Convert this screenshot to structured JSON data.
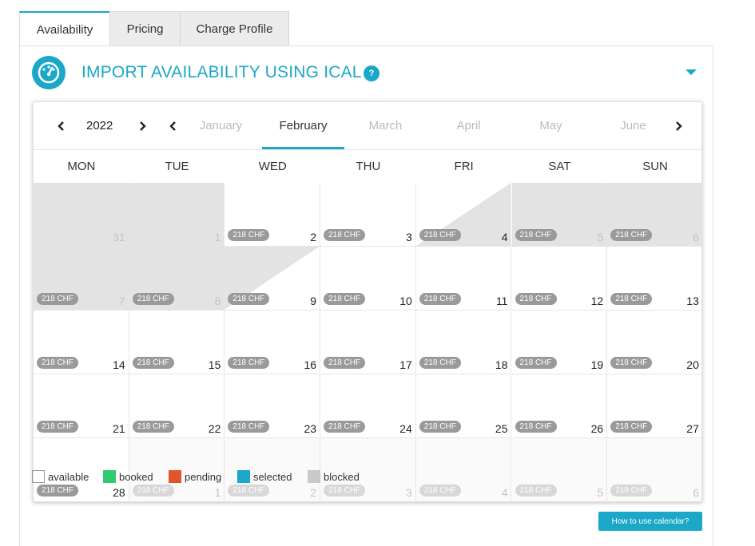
{
  "tabs": [
    {
      "label": "Availability"
    },
    {
      "label": "Pricing"
    },
    {
      "label": "Charge Profile"
    }
  ],
  "panel": {
    "title": "IMPORT AVAILABILITY USING ICAL",
    "help": "?",
    "icon": "speedometer-icon"
  },
  "calendar": {
    "year": "2022",
    "months": [
      "January",
      "February",
      "March",
      "April",
      "May",
      "June"
    ],
    "active_month": "February",
    "weekdays": [
      "MON",
      "TUE",
      "WED",
      "THU",
      "FRI",
      "SAT",
      "SUN"
    ],
    "days": [
      {
        "day": "31",
        "price": "",
        "state": "blocked"
      },
      {
        "day": "1",
        "price": "",
        "state": "blocked"
      },
      {
        "day": "2",
        "price": "218 CHF",
        "state": "available"
      },
      {
        "day": "3",
        "price": "218 CHF",
        "state": "available"
      },
      {
        "day": "4",
        "price": "218 CHF",
        "state": "blocked-start"
      },
      {
        "day": "5",
        "price": "218 CHF",
        "state": "blocked"
      },
      {
        "day": "6",
        "price": "218 CHF",
        "state": "blocked"
      },
      {
        "day": "7",
        "price": "218 CHF",
        "state": "blocked"
      },
      {
        "day": "8",
        "price": "218 CHF",
        "state": "blocked"
      },
      {
        "day": "9",
        "price": "218 CHF",
        "state": "blocked-end"
      },
      {
        "day": "10",
        "price": "218 CHF",
        "state": "available"
      },
      {
        "day": "11",
        "price": "218 CHF",
        "state": "available"
      },
      {
        "day": "12",
        "price": "218 CHF",
        "state": "available"
      },
      {
        "day": "13",
        "price": "218 CHF",
        "state": "available"
      },
      {
        "day": "14",
        "price": "218 CHF",
        "state": "available"
      },
      {
        "day": "15",
        "price": "218 CHF",
        "state": "available"
      },
      {
        "day": "16",
        "price": "218 CHF",
        "state": "available"
      },
      {
        "day": "17",
        "price": "218 CHF",
        "state": "available"
      },
      {
        "day": "18",
        "price": "218 CHF",
        "state": "available"
      },
      {
        "day": "19",
        "price": "218 CHF",
        "state": "available"
      },
      {
        "day": "20",
        "price": "218 CHF",
        "state": "available"
      },
      {
        "day": "21",
        "price": "218 CHF",
        "state": "available"
      },
      {
        "day": "22",
        "price": "218 CHF",
        "state": "available"
      },
      {
        "day": "23",
        "price": "218 CHF",
        "state": "available"
      },
      {
        "day": "24",
        "price": "218 CHF",
        "state": "available"
      },
      {
        "day": "25",
        "price": "218 CHF",
        "state": "available"
      },
      {
        "day": "26",
        "price": "218 CHF",
        "state": "available"
      },
      {
        "day": "27",
        "price": "218 CHF",
        "state": "available"
      },
      {
        "day": "28",
        "price": "218 CHF",
        "state": "available"
      },
      {
        "day": "1",
        "price": "218 CHF",
        "state": "other-month"
      },
      {
        "day": "2",
        "price": "218 CHF",
        "state": "other-month"
      },
      {
        "day": "3",
        "price": "218 CHF",
        "state": "other-month"
      },
      {
        "day": "4",
        "price": "218 CHF",
        "state": "other-month"
      },
      {
        "day": "5",
        "price": "218 CHF",
        "state": "other-month"
      },
      {
        "day": "6",
        "price": "218 CHF",
        "state": "other-month"
      }
    ]
  },
  "legend": [
    {
      "label": "available",
      "color": "#ffffff"
    },
    {
      "label": "booked",
      "color": "#2ecc71"
    },
    {
      "label": "pending",
      "color": "#e0562a"
    },
    {
      "label": "selected",
      "color": "#1aa7c8"
    },
    {
      "label": "blocked",
      "color": "#c9c9c9"
    }
  ],
  "help_button": "How to use calendar?"
}
